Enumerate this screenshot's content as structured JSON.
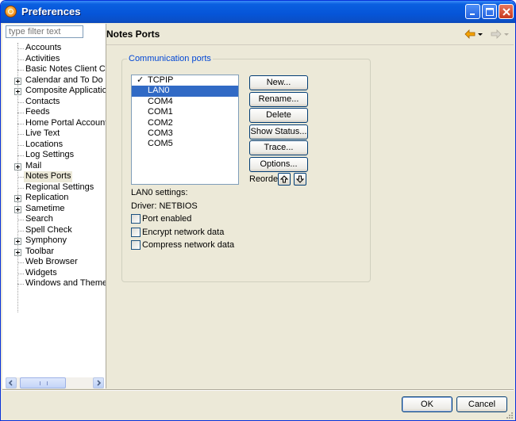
{
  "window": {
    "title": "Preferences"
  },
  "filter": {
    "placeholder": "type filter text"
  },
  "tree": {
    "items": [
      {
        "label": "Accounts",
        "expandable": false
      },
      {
        "label": "Activities",
        "expandable": false
      },
      {
        "label": "Basic Notes Client Config",
        "expandable": false
      },
      {
        "label": "Calendar and To Do",
        "expandable": true
      },
      {
        "label": "Composite Application Ed",
        "expandable": true
      },
      {
        "label": "Contacts",
        "expandable": false
      },
      {
        "label": "Feeds",
        "expandable": false
      },
      {
        "label": "Home Portal Account",
        "expandable": false
      },
      {
        "label": "Live Text",
        "expandable": false
      },
      {
        "label": "Locations",
        "expandable": false
      },
      {
        "label": "Log Settings",
        "expandable": false
      },
      {
        "label": "Mail",
        "expandable": true
      },
      {
        "label": "Notes Ports",
        "expandable": false,
        "selected": true
      },
      {
        "label": "Regional Settings",
        "expandable": false
      },
      {
        "label": "Replication",
        "expandable": true
      },
      {
        "label": "Sametime",
        "expandable": true
      },
      {
        "label": "Search",
        "expandable": false
      },
      {
        "label": "Spell Check",
        "expandable": false
      },
      {
        "label": "Symphony",
        "expandable": true
      },
      {
        "label": "Toolbar",
        "expandable": true
      },
      {
        "label": "Web Browser",
        "expandable": false
      },
      {
        "label": "Widgets",
        "expandable": false
      },
      {
        "label": "Windows and Themes",
        "expandable": false
      }
    ]
  },
  "page": {
    "title": "Notes Ports",
    "group_label": "Communication ports",
    "ports": [
      {
        "label": "TCPIP",
        "checked": true
      },
      {
        "label": "LAN0",
        "selected": true
      },
      {
        "label": "COM4"
      },
      {
        "label": "COM1"
      },
      {
        "label": "COM2"
      },
      {
        "label": "COM3"
      },
      {
        "label": "COM5"
      }
    ],
    "buttons": {
      "new": "New...",
      "rename": "Rename...",
      "delete": "Delete",
      "show_status": "Show Status...",
      "trace": "Trace...",
      "options": "Options..."
    },
    "reorder_label": "Reorder",
    "settings_label": "LAN0 settings:",
    "driver": "Driver: NETBIOS",
    "checkboxes": {
      "port_enabled": "Port enabled",
      "encrypt": "Encrypt network data",
      "compress": "Compress network data"
    }
  },
  "footer": {
    "ok": "OK",
    "cancel": "Cancel"
  },
  "colors": {
    "title_bar": "#0a5fe0",
    "selection": "#316ac5",
    "group_label": "#0046d5",
    "nav_arrow": "#f5a300"
  }
}
